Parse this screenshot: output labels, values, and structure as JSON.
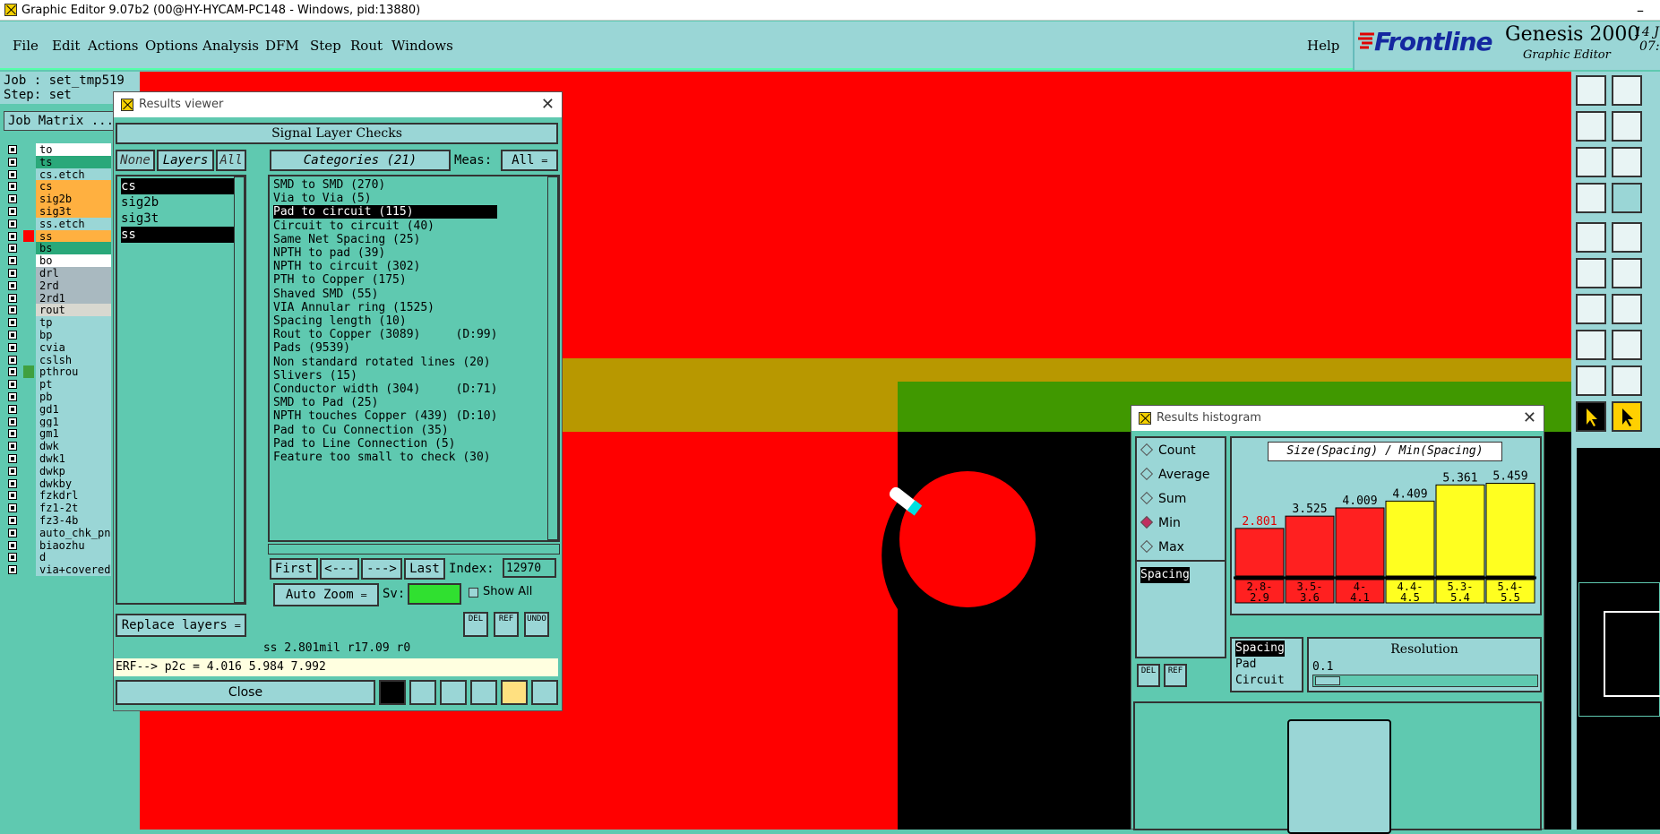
{
  "window": {
    "title": "Graphic Editor 9.07b2 (00@HY-HYCAM-PC148 - Windows, pid:13880)",
    "minimize_glyph": "–"
  },
  "menubar": {
    "items": [
      "File",
      "Edit",
      "Actions",
      "Options",
      "Analysis",
      "DFM",
      "Step",
      "Rout",
      "Windows"
    ],
    "help": "Help"
  },
  "brand": {
    "logo": "Frontline",
    "product": "Genesis 2000",
    "subtitle": "Graphic Editor",
    "date_fragment": "14 J",
    "time_fragment": "07:"
  },
  "job": {
    "job_label": "Job : set_tmp519",
    "step_label": "Step: set",
    "matrix_button": "Job Matrix ..."
  },
  "layers": [
    {
      "name": "to",
      "color": "#ffffff"
    },
    {
      "name": "ts",
      "color": "#2aa87a"
    },
    {
      "name": "cs.etch",
      "color": "#9ad6d6"
    },
    {
      "name": "cs",
      "color": "#ffb040"
    },
    {
      "name": "sig2b",
      "color": "#ffb040"
    },
    {
      "name": "sig3t",
      "color": "#ffb040"
    },
    {
      "name": "ss.etch",
      "color": "#9ad6d6"
    },
    {
      "name": "ss",
      "color": "#ffb040",
      "swatch": "#ff0000"
    },
    {
      "name": "bs",
      "color": "#2aa87a"
    },
    {
      "name": "bo",
      "color": "#ffffff"
    },
    {
      "name": "drl",
      "color": "#a9b9c0"
    },
    {
      "name": "2rd",
      "color": "#a9b9c0"
    },
    {
      "name": "2rd1",
      "color": "#a9b9c0"
    },
    {
      "name": "rout",
      "color": "#d8d8d0"
    },
    {
      "name": "tp",
      "color": "#9ad6d6"
    },
    {
      "name": "bp",
      "color": "#9ad6d6"
    },
    {
      "name": "cvia",
      "color": "#9ad6d6"
    },
    {
      "name": "cslsh",
      "color": "#9ad6d6"
    },
    {
      "name": "pthrou",
      "color": "#9ad6d6",
      "swatch": "#40a040"
    },
    {
      "name": "pt",
      "color": "#9ad6d6"
    },
    {
      "name": "pb",
      "color": "#9ad6d6"
    },
    {
      "name": "gd1",
      "color": "#9ad6d6"
    },
    {
      "name": "gg1",
      "color": "#9ad6d6"
    },
    {
      "name": "gm1",
      "color": "#9ad6d6"
    },
    {
      "name": "dwk",
      "color": "#9ad6d6"
    },
    {
      "name": "dwk1",
      "color": "#9ad6d6"
    },
    {
      "name": "dwkp",
      "color": "#9ad6d6"
    },
    {
      "name": "dwkby",
      "color": "#9ad6d6"
    },
    {
      "name": "fzkdrl",
      "color": "#9ad6d6"
    },
    {
      "name": "fz1-2t",
      "color": "#9ad6d6"
    },
    {
      "name": "fz3-4b",
      "color": "#9ad6d6"
    },
    {
      "name": "auto_chk_pn",
      "color": "#9ad6d6"
    },
    {
      "name": "biaozhu",
      "color": "#9ad6d6"
    },
    {
      "name": "d",
      "color": "#9ad6d6"
    },
    {
      "name": "via+covered",
      "color": "#9ad6d6"
    }
  ],
  "results_viewer": {
    "title": "Results viewer",
    "header": "Signal Layer Checks",
    "none_btn": "None",
    "layers_btn": "Layers",
    "all_btn": "All",
    "layer_list": [
      "cs",
      "sig2b",
      "sig3t",
      "ss"
    ],
    "categories_btn": "Categories (21)",
    "meas_label": "Meas:",
    "meas_value": "All",
    "categories": [
      "SMD to SMD (270)",
      "Via to Via (5)",
      "Pad to circuit (115)",
      "Circuit to circuit (40)",
      "Same Net Spacing (25)",
      "NPTH to pad (39)",
      "NPTH to circuit (302)",
      "PTH to Copper (175)",
      "Shaved SMD (55)",
      "VIA Annular ring (1525)",
      "Spacing length (10)",
      "Rout to Copper (3089)     (D:99)",
      "Pads (9539)",
      "Non standard rotated lines (20)",
      "Slivers (15)",
      "Conductor width (304)     (D:71)",
      "SMD to Pad (25)",
      "NPTH touches Copper (439) (D:10)",
      "Pad to Cu Connection (35)",
      "Pad to Line Connection (5)",
      "Feature too small to check (30)"
    ],
    "first": "First",
    "prev": "<---",
    "next": "--->",
    "last": "Last",
    "index_label": "Index:",
    "index_value": "12970",
    "zoom_btn": "Auto Zoom",
    "sv_label": "Sv:",
    "show_all": "Show All",
    "replace_btn": "Replace layers",
    "del": "DEL",
    "ref": "REF",
    "undo": "UNDO",
    "status": "ss 2.801mil  r17.09  r0",
    "erf": "ERF--> p2c = 4.016 5.984 7.992",
    "close": "Close"
  },
  "histogram": {
    "title": "Results histogram",
    "options": [
      {
        "label": "Count",
        "checked": false
      },
      {
        "label": "Average",
        "checked": false
      },
      {
        "label": "Sum",
        "checked": false
      },
      {
        "label": "Min",
        "checked": true
      },
      {
        "label": "Max",
        "checked": false
      }
    ],
    "spacing_list": [
      "Spacing"
    ],
    "chart_title": "Size(Spacing) / Min(Spacing)",
    "resolution_label": "Resolution",
    "resolution_value": "0.1",
    "type_list": [
      "Spacing",
      "Pad",
      "Circuit"
    ],
    "del": "DEL",
    "ref": "REF"
  },
  "chart_data": {
    "type": "bar",
    "title": "Size(Spacing) / Min(Spacing)",
    "categories": [
      "2.8-\n2.9",
      "3.5-\n3.6",
      "4-\n4.1",
      "4.4-\n4.5",
      "5.3-\n5.4",
      "5.4-\n5.5"
    ],
    "values": [
      2.801,
      3.525,
      4.009,
      4.409,
      5.361,
      5.459
    ],
    "value_labels": [
      "2.801",
      "3.525",
      "4.009",
      "4.409",
      "5.361",
      "5.459"
    ],
    "colors": [
      "#ff2020",
      "#ff2020",
      "#ff2020",
      "#ffff20",
      "#ffff20",
      "#ffff20"
    ],
    "ylim": [
      0,
      5.8
    ]
  },
  "colors": {
    "canvas_red": "#ff0000",
    "panel": "#5fc9b0",
    "panel_light": "#9ad6d6",
    "gold": "#b89800",
    "green": "#409800"
  }
}
